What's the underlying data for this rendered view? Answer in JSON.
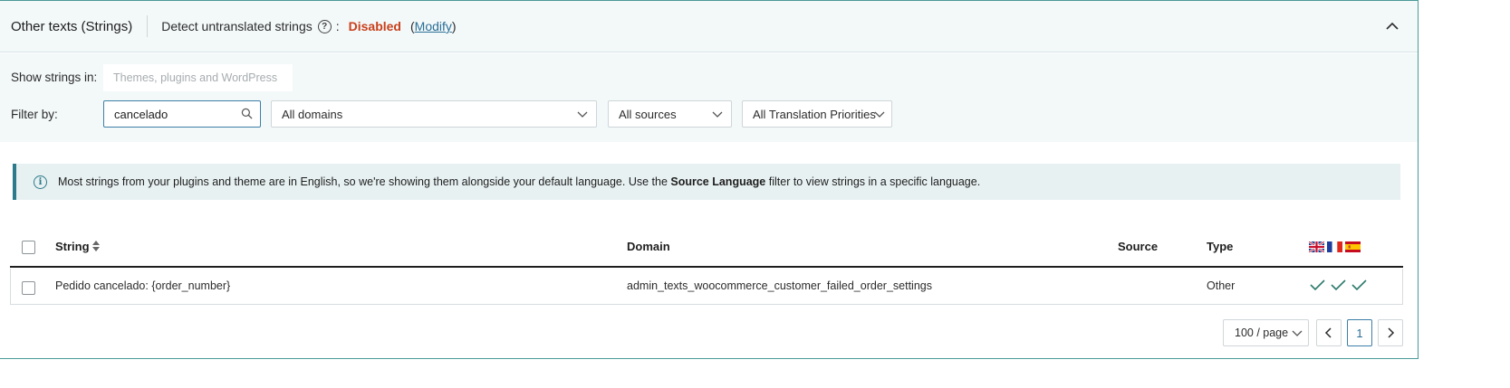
{
  "header": {
    "title": "Other texts (Strings)",
    "detect_label": "Detect untranslated strings",
    "help_glyph": "?",
    "colon": ":",
    "status": "Disabled",
    "modify_open": "(",
    "modify_label": "Modify",
    "modify_close": ")",
    "status_color": "#c9401b"
  },
  "filters": {
    "show_label": "Show strings in:",
    "show_placeholder": "Themes, plugins and WordPress",
    "filter_label": "Filter by:",
    "search_value": "cancelado",
    "domain_select": "All domains",
    "source_select": "All sources",
    "priority_select": "All Translation Priorities"
  },
  "notice": {
    "text_before": "Most strings from your plugins and theme are in English, so we're showing them alongside your default language. Use the ",
    "bold": "Source Language",
    "text_after": " filter to view strings in a specific language."
  },
  "table": {
    "columns": {
      "string": "String",
      "domain": "Domain",
      "source": "Source",
      "type": "Type"
    },
    "language_flags": [
      "en-gb-flag-icon",
      "fr-flag-icon",
      "es-flag-icon"
    ],
    "rows": [
      {
        "string": "Pedido cancelado: {order_number}",
        "domain": "admin_texts_woocommerce_customer_failed_order_settings",
        "source": "",
        "type": "Other",
        "translations": [
          "check-icon",
          "check-icon",
          "check-icon"
        ]
      }
    ]
  },
  "pagination": {
    "per_page": "100 / page",
    "current_page": "1"
  },
  "colors": {
    "accent": "#2c7a8c",
    "check": "#2c7a6c",
    "link": "#2a6f97"
  }
}
